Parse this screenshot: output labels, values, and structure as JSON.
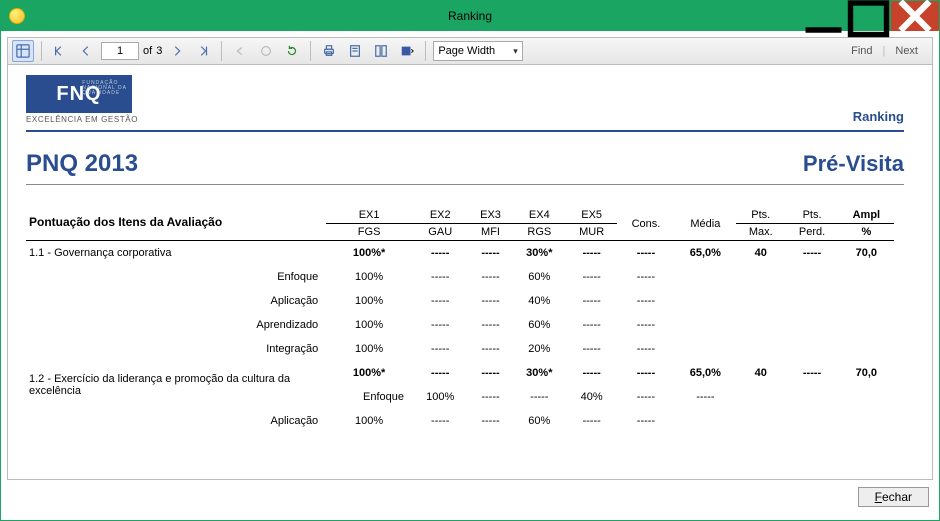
{
  "window": {
    "title": "Ranking"
  },
  "toolbar": {
    "page_current": "1",
    "of_label": "of",
    "page_total": "3",
    "zoom": "Page Width",
    "find": "Find",
    "next": "Next"
  },
  "report": {
    "logo_text": "FNQ",
    "logo_excellence": "EXCELÊNCIA EM GESTÃO",
    "ranking_label": "Ranking",
    "title": "PNQ 2013",
    "phase": "Pré-Visita",
    "section_title": "Pontuação dos Itens da Avaliação",
    "headers": {
      "ex1a": "EX1",
      "ex1b": "FGS",
      "ex2a": "EX2",
      "ex2b": "GAU",
      "ex3a": "EX3",
      "ex3b": "MFI",
      "ex4a": "EX4",
      "ex4b": "RGS",
      "ex5a": "EX5",
      "ex5b": "MUR",
      "cons": "Cons.",
      "media": "Média",
      "ptsmax1": "Pts.",
      "ptsmax2": "Max.",
      "ptsperd1": "Pts.",
      "ptsperd2": "Perd.",
      "ampl1": "Ampl",
      "ampl2": "%"
    },
    "rows": [
      {
        "type": "main",
        "label": "1.1 - Governança corporativa",
        "c": [
          "100%*",
          "-----",
          "-----",
          "30%*",
          "-----",
          "-----",
          "65,0%",
          "40",
          "-----",
          "70,0"
        ]
      },
      {
        "type": "sub",
        "label": "Enfoque",
        "c": [
          "100%",
          "-----",
          "-----",
          "60%",
          "-----",
          "-----",
          "",
          "",
          "",
          ""
        ]
      },
      {
        "type": "sub",
        "label": "Aplicação",
        "c": [
          "100%",
          "-----",
          "-----",
          "40%",
          "-----",
          "-----",
          "",
          "",
          "",
          ""
        ]
      },
      {
        "type": "sub",
        "label": "Aprendizado",
        "c": [
          "100%",
          "-----",
          "-----",
          "60%",
          "-----",
          "-----",
          "",
          "",
          "",
          ""
        ]
      },
      {
        "type": "sub",
        "label": "Integração",
        "c": [
          "100%",
          "-----",
          "-----",
          "20%",
          "-----",
          "-----",
          "",
          "",
          "",
          ""
        ]
      },
      {
        "type": "main",
        "label": "1.2 - Exercício da liderança e promoção da cultura da excelência",
        "c": [
          "100%*",
          "-----",
          "-----",
          "30%*",
          "-----",
          "-----",
          "65,0%",
          "40",
          "-----",
          "70,0"
        ]
      },
      {
        "type": "sub",
        "label": "Enfoque",
        "c": [
          "100%",
          "-----",
          "-----",
          "40%",
          "-----",
          "-----",
          "",
          "",
          "",
          ""
        ]
      },
      {
        "type": "sub",
        "label": "Aplicação",
        "c": [
          "100%",
          "-----",
          "-----",
          "60%",
          "-----",
          "-----",
          "",
          "",
          "",
          ""
        ]
      }
    ]
  },
  "footer": {
    "close_rest": "echar"
  }
}
